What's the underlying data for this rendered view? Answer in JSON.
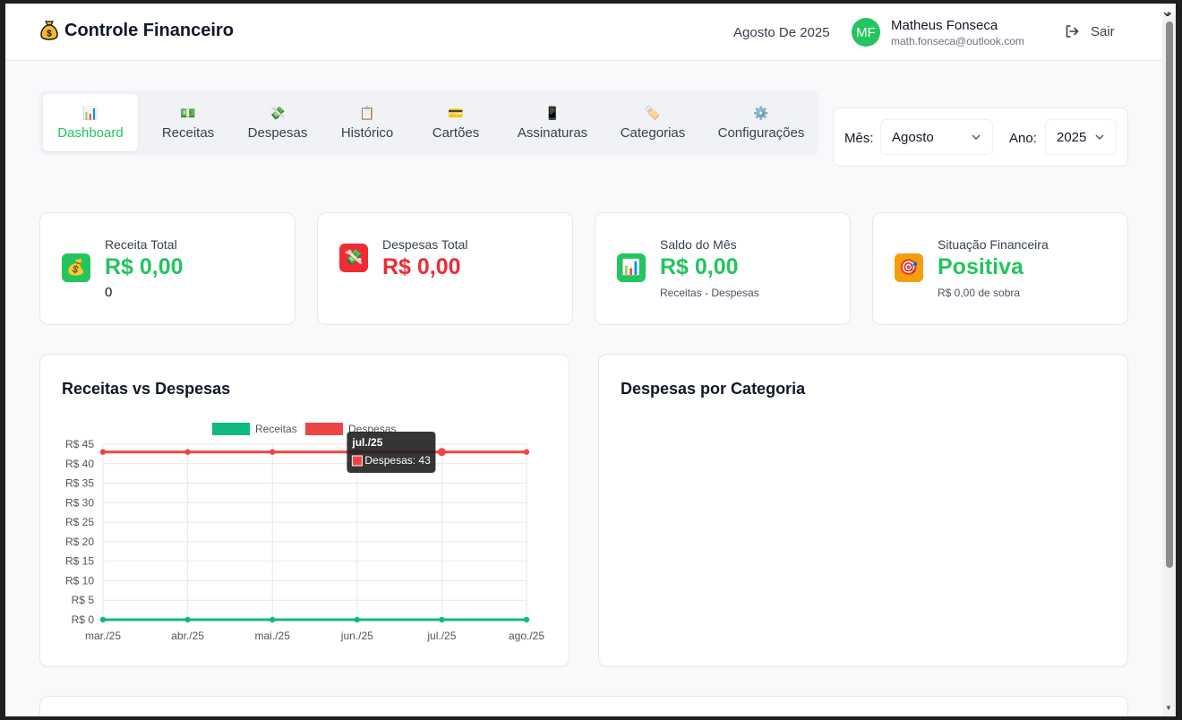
{
  "header": {
    "brand_icon": "money-bag-icon",
    "title": "Controle Financeiro",
    "period": "Agosto De 2025",
    "user": {
      "initials": "MF",
      "name": "Matheus Fonseca",
      "email": "math.fonseca@outlook.com"
    },
    "logout_label": "Sair",
    "close_glyph": "✕"
  },
  "tabs": [
    {
      "label": "Dashboard",
      "icon": "📊",
      "active": true
    },
    {
      "label": "Receitas",
      "icon": "💵"
    },
    {
      "label": "Despesas",
      "icon": "💸"
    },
    {
      "label": "Histórico",
      "icon": "📋"
    },
    {
      "label": "Cartões",
      "icon": "💳"
    },
    {
      "label": "Assinaturas",
      "icon": "📱"
    },
    {
      "label": "Categorias",
      "icon": "🏷️"
    },
    {
      "label": "Configurações",
      "icon": "⚙️"
    }
  ],
  "filter": {
    "month_label": "Mês:",
    "month_value": "Agosto",
    "year_label": "Ano:",
    "year_value": "2025"
  },
  "cards": [
    {
      "title": "Receita Total",
      "value": "R$ 0,00",
      "sub": "0",
      "icon": "💰",
      "icon_bg": "#22c55e"
    },
    {
      "title": "Despesas Total",
      "value": "R$ 0,00",
      "sub": "",
      "icon": "💸",
      "icon_bg": "#ef2b36"
    },
    {
      "title": "Saldo do Mês",
      "value": "R$ 0,00",
      "sub": "Receitas - Despesas",
      "icon": "📊",
      "icon_bg": "#22c55e"
    },
    {
      "title": "Situação Financeira",
      "value": "Positiva",
      "sub": "R$ 0,00 de sobra",
      "icon": "🎯",
      "icon_bg": "#f59e0b"
    }
  ],
  "panels": {
    "line_title": "Receitas vs Despesas",
    "category_title": "Despesas por Categoria"
  },
  "chart_data": {
    "type": "line",
    "categories": [
      "mar./25",
      "abr./25",
      "mai./25",
      "jun./25",
      "jul./25",
      "ago./25"
    ],
    "series": [
      {
        "name": "Receitas",
        "values": [
          0,
          0,
          0,
          0,
          0,
          0
        ],
        "color": "#10b981"
      },
      {
        "name": "Despesas",
        "values": [
          43,
          43,
          43,
          43,
          43,
          43
        ],
        "color": "#ef4444"
      }
    ],
    "yticks": [
      "R$ 0",
      "R$ 5",
      "R$ 10",
      "R$ 15",
      "R$ 20",
      "R$ 25",
      "R$ 30",
      "R$ 35",
      "R$ 40",
      "R$ 45"
    ],
    "ylim": [
      0,
      45
    ],
    "grid": true,
    "legend": "top",
    "tooltip": {
      "title": "jul./25",
      "text": "Despesas: 43",
      "category": "jul./25",
      "series": "Despesas"
    }
  }
}
